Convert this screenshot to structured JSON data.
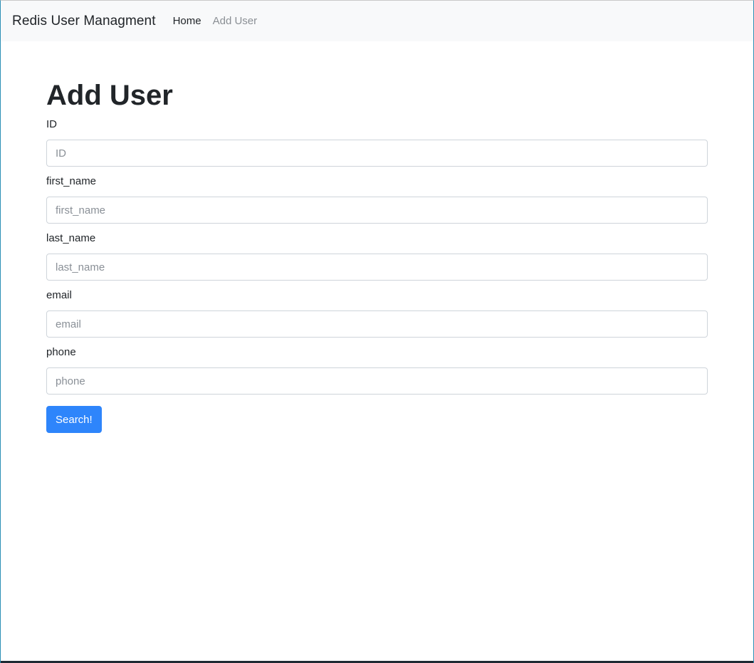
{
  "navbar": {
    "brand": "Redis User Managment",
    "links": [
      {
        "label": "Home"
      },
      {
        "label": "Add User"
      }
    ]
  },
  "main": {
    "title": "Add User",
    "fields": [
      {
        "label": "ID",
        "placeholder": "ID"
      },
      {
        "label": "first_name",
        "placeholder": "first_name"
      },
      {
        "label": "last_name",
        "placeholder": "last_name"
      },
      {
        "label": "email",
        "placeholder": "email"
      },
      {
        "label": "phone",
        "placeholder": "phone"
      }
    ],
    "submit_label": "Search!"
  },
  "colors": {
    "primary": "#2e85fb",
    "navbar_bg": "#f8f9fa",
    "nav_muted": "#8a8f94"
  }
}
